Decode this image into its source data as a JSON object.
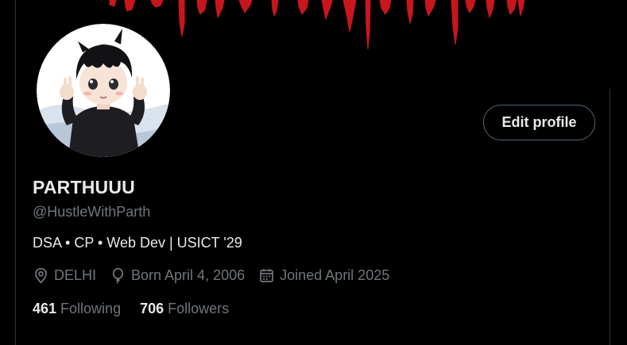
{
  "colors": {
    "background": "#000000",
    "text_primary": "#e7e9ea",
    "text_secondary": "#71767b",
    "banner_red": "#c8161d",
    "button_border": "#536471"
  },
  "banner": {
    "description_icon": "banner-image"
  },
  "avatar": {
    "icon": "avatar"
  },
  "edit_profile": {
    "label": "Edit profile"
  },
  "profile": {
    "name": "PARTHUUU",
    "handle": "@HustleWithParth",
    "bio": "DSA • CP • Web Dev | USICT '29"
  },
  "meta": {
    "location": {
      "icon": "location-pin-icon",
      "text": "DELHI"
    },
    "birthday": {
      "icon": "balloon-icon",
      "text": "Born April 4, 2006"
    },
    "joined": {
      "icon": "calendar-icon",
      "text": "Joined April 2025"
    }
  },
  "stats": {
    "following": {
      "count": "461",
      "label": "Following"
    },
    "followers": {
      "count": "706",
      "label": "Followers"
    }
  }
}
